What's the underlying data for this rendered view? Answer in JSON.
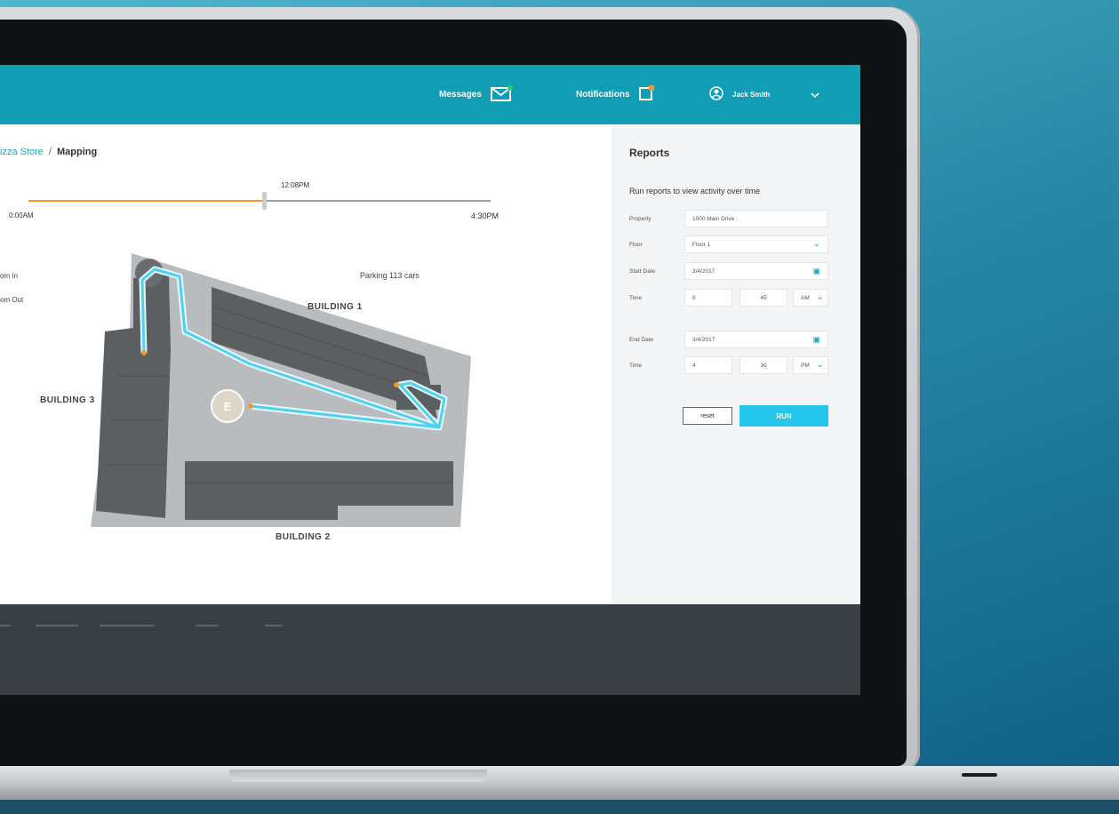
{
  "header": {
    "messages_label": "Messages",
    "notifications_label": "Notifications",
    "user_name": "Jack Smith",
    "colors": {
      "bar": "#119db4",
      "accent": "#f2962e",
      "new_badge": "#27d07a"
    }
  },
  "breadcrumb": {
    "parent": "izza Store",
    "separator": "/",
    "current": "Mapping"
  },
  "timeline": {
    "current_time": "12:08PM",
    "start_time": "0:00AM",
    "end_time": "4:30PM",
    "progress_fraction": 0.51
  },
  "legend": {
    "item1": "om In",
    "item2": "om Out"
  },
  "map": {
    "parking_text": "Parking 113 cars",
    "building1": "BUILDING 1",
    "building2": "BUILDING 2",
    "building3": "BUILDING 3",
    "marker_letter": "E",
    "path_color": "#4fd2f0"
  },
  "reports": {
    "title": "Reports",
    "description": "Run reports to view activity over time",
    "property_label": "Property",
    "property_value": "1000 Main Drive",
    "floor_label": "Floor",
    "floor_value": "Floor 1",
    "start_date_label": "Start Date",
    "start_date_value": "3/4/2017",
    "time_label": "Time",
    "start_hour": "8",
    "start_minute": "45",
    "start_ampm": "AM",
    "end_date_label": "End Date",
    "end_date_value": "3/4/2017",
    "end_hour": "4",
    "end_minute": "30",
    "end_ampm": "PM",
    "reset_label": "reset",
    "run_label": "RUN",
    "run_color": "#24c6ea"
  }
}
